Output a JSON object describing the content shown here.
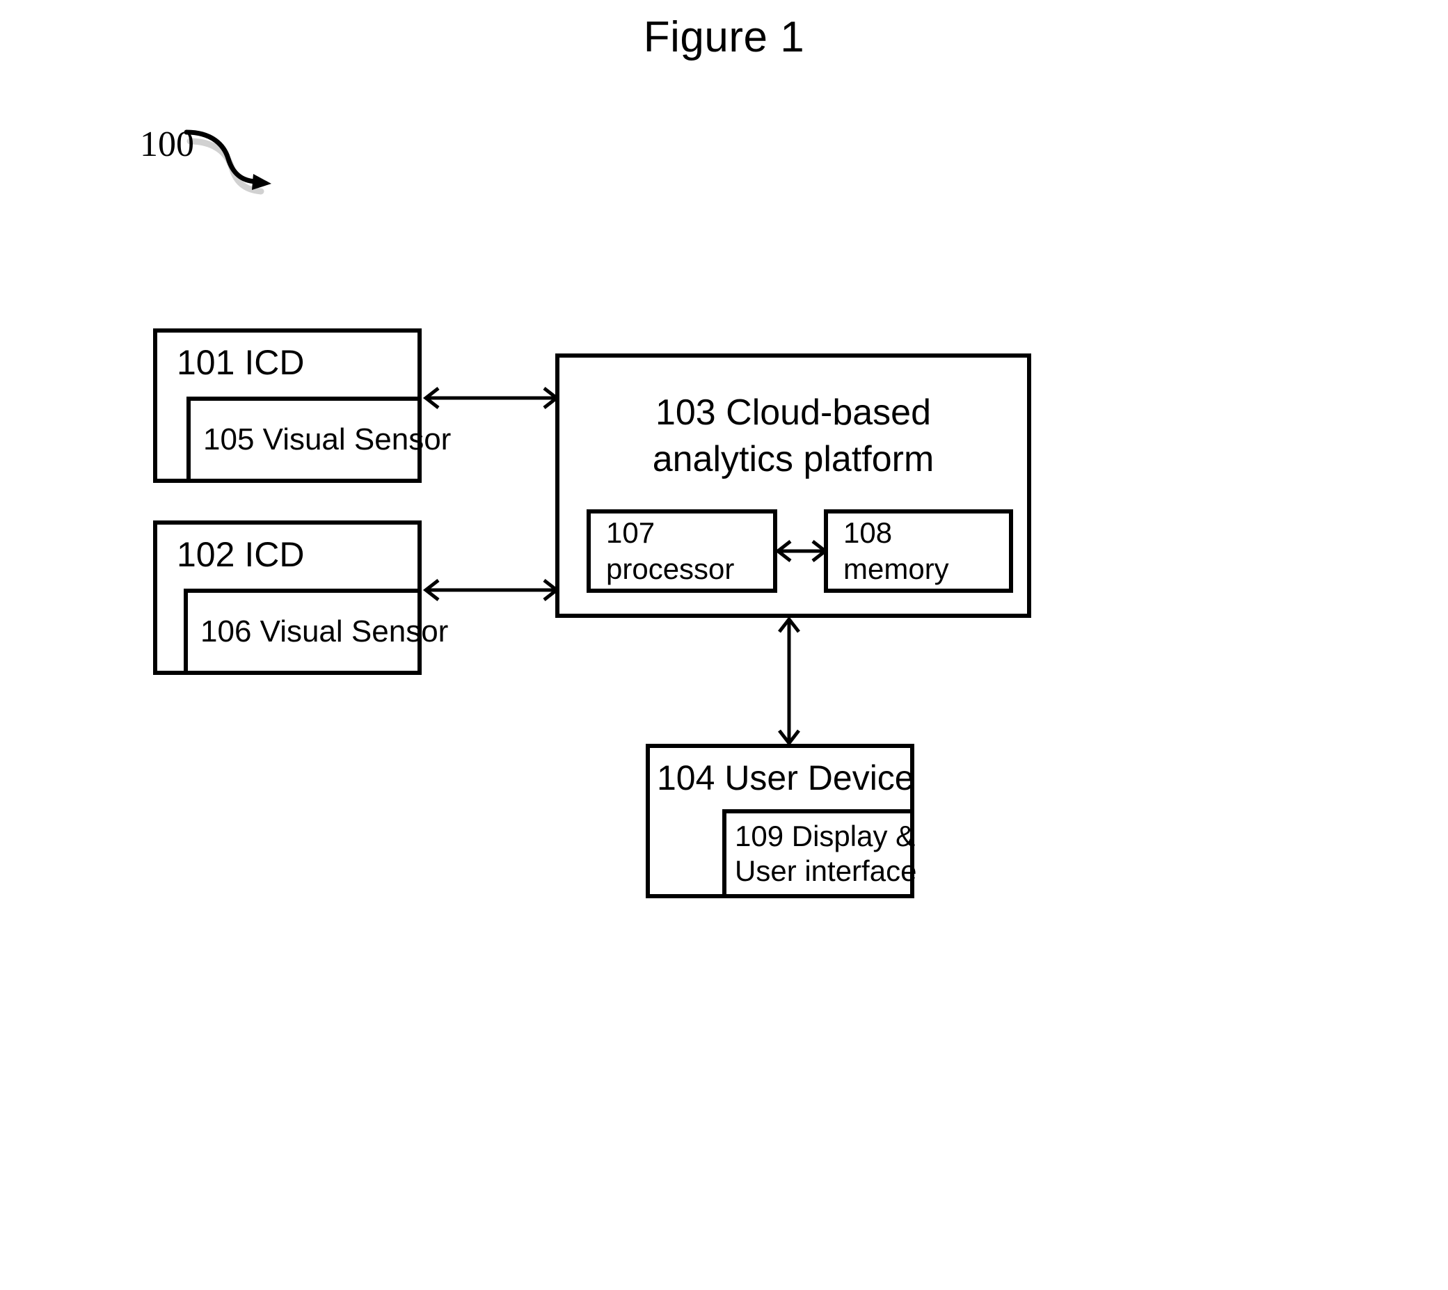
{
  "figure": {
    "title": "Figure 1",
    "reference_numeral": "100"
  },
  "blocks": {
    "icd_101": {
      "id": "101",
      "title": "101 ICD",
      "sensor": {
        "id": "105",
        "label": "105 Visual Sensor"
      }
    },
    "icd_102": {
      "id": "102",
      "title": "102 ICD",
      "sensor": {
        "id": "106",
        "label": "106 Visual Sensor"
      }
    },
    "platform_103": {
      "id": "103",
      "title_line1": "103 Cloud-based",
      "title_line2": "analytics platform",
      "processor": {
        "id": "107",
        "line1": "107",
        "line2": "processor"
      },
      "memory": {
        "id": "108",
        "line1": "108",
        "line2": "memory"
      }
    },
    "user_device_104": {
      "id": "104",
      "title": "104 User Device",
      "display": {
        "id": "109",
        "line1": "109 Display &",
        "line2": "User interface"
      }
    }
  },
  "connectors": [
    {
      "name": "icd-101-to-platform",
      "type": "bidirectional-horizontal"
    },
    {
      "name": "icd-102-to-platform",
      "type": "bidirectional-horizontal"
    },
    {
      "name": "processor-to-memory",
      "type": "bidirectional-horizontal"
    },
    {
      "name": "platform-to-user-device",
      "type": "bidirectional-vertical"
    }
  ],
  "colors": {
    "stroke": "#000000",
    "background": "#ffffff"
  }
}
